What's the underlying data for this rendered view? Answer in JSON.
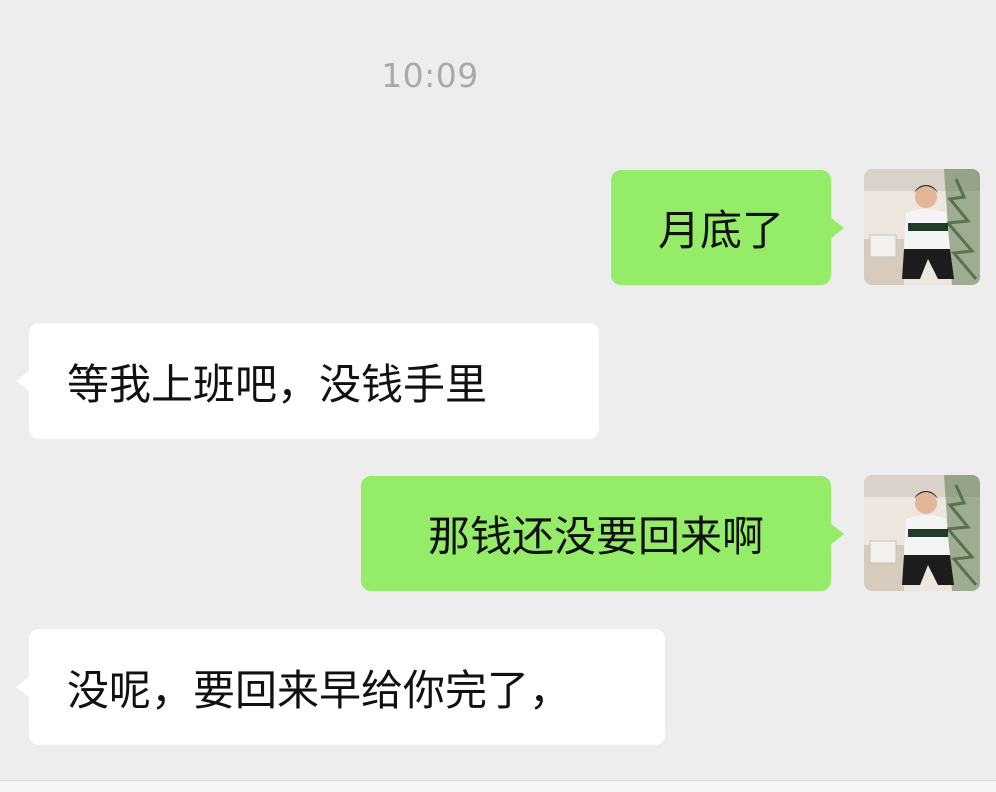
{
  "chat": {
    "timestamp": "10:09",
    "messages": [
      {
        "direction": "outgoing",
        "text": "月底了",
        "avatar_icon": "user-avatar-photo"
      },
      {
        "direction": "incoming",
        "text": "等我上班吧，没钱手里"
      },
      {
        "direction": "outgoing",
        "text": "那钱还没要回来啊",
        "avatar_icon": "user-avatar-photo"
      },
      {
        "direction": "incoming",
        "text": "没呢，要回来早给你完了，"
      }
    ]
  },
  "colors": {
    "background": "#ededed",
    "outgoing_bubble": "#95ec69",
    "incoming_bubble": "#ffffff",
    "timestamp_text": "#a9a9a9",
    "message_text": "#111111"
  }
}
